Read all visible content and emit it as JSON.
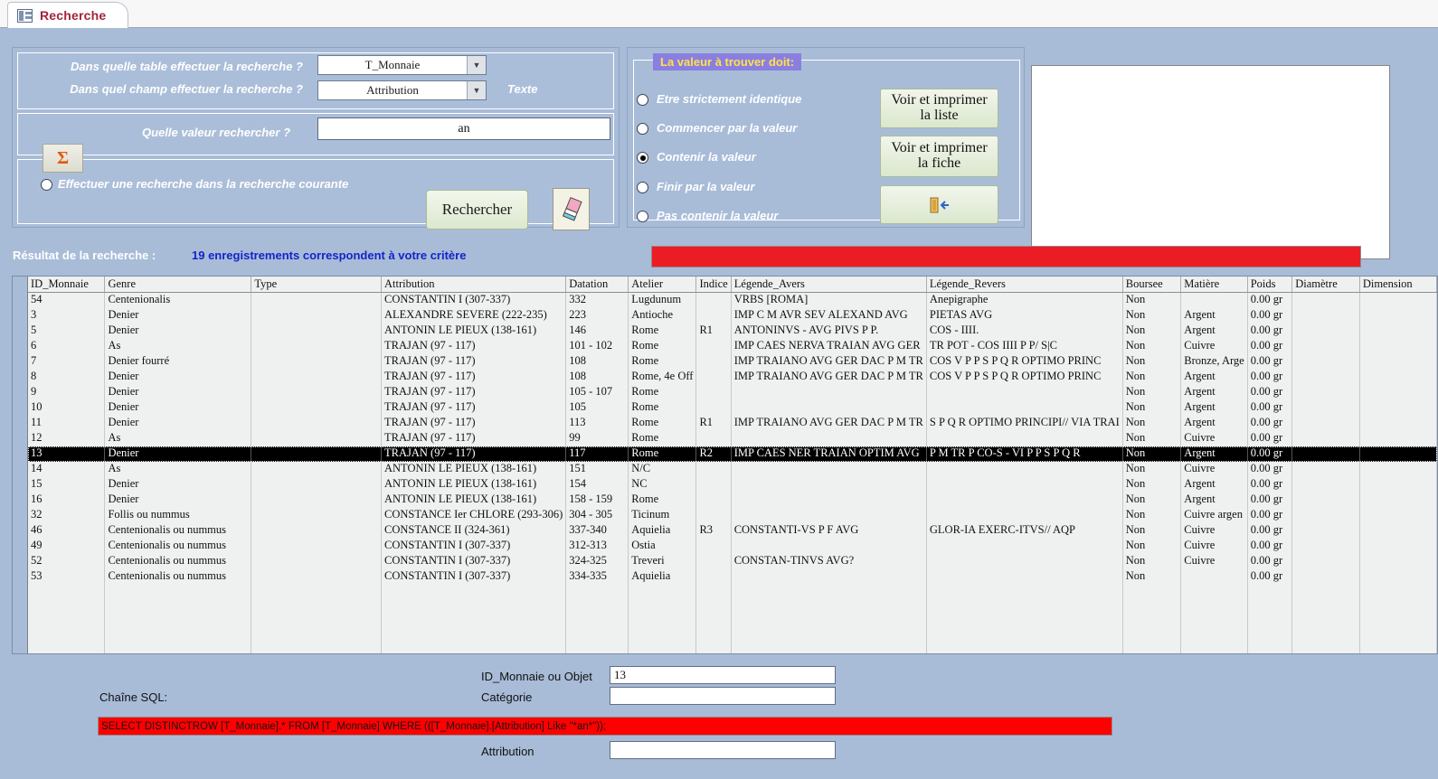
{
  "tab": {
    "label": "Recherche",
    "icon": "table-form-icon"
  },
  "criteria": {
    "table_question": "Dans quelle table effectuer la recherche ?",
    "table_value": "T_Monnaie",
    "field_question": "Dans quel champ effectuer la recherche ?",
    "field_value": "Attribution",
    "field_type": "Texte",
    "value_question": "Quelle valeur rechercher ?",
    "value_entered": "an",
    "sigma_symbol": "Σ",
    "subsearch_label": "Effectuer une recherche dans la recherche courante",
    "subsearch_checked": false,
    "search_button": "Rechercher",
    "eraser_icon": "eraser-icon"
  },
  "mode": {
    "legend": "La valeur à trouver doit:",
    "options": [
      {
        "label": "Etre strictement identique",
        "checked": false
      },
      {
        "label": "Commencer par la valeur",
        "checked": false
      },
      {
        "label": "Contenir la valeur",
        "checked": true
      },
      {
        "label": "Finir par la valeur",
        "checked": false
      },
      {
        "label": "Pas contenir la valeur",
        "checked": false
      }
    ]
  },
  "actions": {
    "print_list_line1": "Voir et imprimer",
    "print_list_line2": "la liste",
    "print_record_line1": "Voir et imprimer",
    "print_record_line2": "la fiche",
    "exit_icon": "exit-door-icon"
  },
  "result": {
    "label": "Résultat de la recherche :",
    "count_text": "19 enregistrements correspondent à votre critère",
    "banner_text": ""
  },
  "grid": {
    "columns": [
      "ID_Monnaie",
      "Genre",
      "Type",
      "Attribution",
      "Datation",
      "Atelier",
      "Indice",
      "Légende_Avers",
      "Légende_Revers",
      "Boursee",
      "Matière",
      "Poids",
      "Diamètre",
      "Dimension"
    ],
    "selected_row_index": 10,
    "rows": [
      [
        "54",
        "Centenionalis",
        "",
        "CONSTANTIN I (307-337)",
        "332",
        "Lugdunum",
        "",
        "VRBS [ROMA]",
        "Anepigraphe",
        "Non",
        "",
        "0.00 gr",
        "",
        ""
      ],
      [
        "3",
        "Denier",
        "",
        "ALEXANDRE SEVERE (222-235)",
        "223",
        "Antioche",
        "",
        "IMP C M AVR SEV ALEXAND AVG",
        "PIETAS AVG",
        "Non",
        "Argent",
        "0.00 gr",
        "",
        ""
      ],
      [
        "5",
        "Denier",
        "",
        "ANTONIN LE PIEUX (138-161)",
        "146",
        "Rome",
        "R1",
        "ANTONINVS - AVG PIVS P P.",
        "COS - IIII.",
        "Non",
        "Argent",
        "0.00 gr",
        "",
        ""
      ],
      [
        "6",
        "As",
        "",
        "TRAJAN (97 - 117)",
        "101 - 102",
        "Rome",
        "",
        "IMP CAES NERVA TRAIAN AVG GER",
        "TR POT - COS IIII P P/ S|C",
        "Non",
        "Cuivre",
        "0.00 gr",
        "",
        ""
      ],
      [
        "7",
        "Denier fourré",
        "",
        "TRAJAN (97 - 117)",
        "108",
        "Rome",
        "",
        "IMP TRAIANO AVG GER DAC P M TR",
        "COS V P P S P Q R OPTIMO PRINC",
        "Non",
        "Bronze, Arge",
        "0.00 gr",
        "",
        ""
      ],
      [
        "8",
        "Denier",
        "",
        "TRAJAN (97 - 117)",
        "108",
        "Rome, 4e Off",
        "",
        "IMP TRAIANO AVG GER DAC P M TR",
        "COS V P P S P Q R OPTIMO PRINC",
        "Non",
        "Argent",
        "0.00 gr",
        "",
        ""
      ],
      [
        "9",
        "Denier",
        "",
        "TRAJAN (97 - 117)",
        "105 - 107",
        "Rome",
        "",
        "",
        "",
        "Non",
        "Argent",
        "0.00 gr",
        "",
        ""
      ],
      [
        "10",
        "Denier",
        "",
        "TRAJAN (97 - 117)",
        "105",
        "Rome",
        "",
        "",
        "",
        "Non",
        "Argent",
        "0.00 gr",
        "",
        ""
      ],
      [
        "11",
        "Denier",
        "",
        "TRAJAN (97 - 117)",
        "113",
        "Rome",
        "R1",
        "IMP TRAIANO AVG GER DAC P M TR",
        "S P Q R OPTIMO PRINCIPI// VIA TRAI",
        "Non",
        "Argent",
        "0.00 gr",
        "",
        ""
      ],
      [
        "12",
        "As",
        "",
        "TRAJAN (97 - 117)",
        "99",
        "Rome",
        "",
        "",
        "",
        "Non",
        "Cuivre",
        "0.00 gr",
        "",
        ""
      ],
      [
        "13",
        "Denier",
        "",
        "TRAJAN (97 - 117)",
        "117",
        "Rome",
        "R2",
        "IMP CAES NER TRAIAN OPTIM AVG",
        "P M TR P CO-S - VI P P S P Q R",
        "Non",
        "Argent",
        "0.00 gr",
        "",
        ""
      ],
      [
        "14",
        "As",
        "",
        "ANTONIN LE PIEUX (138-161)",
        "151",
        "N/C",
        "",
        "",
        "",
        "Non",
        "Cuivre",
        "0.00 gr",
        "",
        ""
      ],
      [
        "15",
        "Denier",
        "",
        "ANTONIN LE PIEUX (138-161)",
        "154",
        "NC",
        "",
        "",
        "",
        "Non",
        "Argent",
        "0.00 gr",
        "",
        ""
      ],
      [
        "16",
        "Denier",
        "",
        "ANTONIN LE PIEUX (138-161)",
        "158 - 159",
        "Rome",
        "",
        "",
        "",
        "Non",
        "Argent",
        "0.00 gr",
        "",
        ""
      ],
      [
        "32",
        "Follis ou nummus",
        "",
        "CONSTANCE Ier CHLORE (293-306)",
        "304 - 305",
        "Ticinum",
        "",
        "",
        "",
        "Non",
        "Cuivre argen",
        "0.00 gr",
        "",
        ""
      ],
      [
        "46",
        "Centenionalis ou nummus",
        "",
        "CONSTANCE II (324-361)",
        "337-340",
        "Aquielia",
        "R3",
        "CONSTANTI-VS P F AVG",
        "GLOR-IA EXERC-ITVS// AQP",
        "Non",
        "Cuivre",
        "0.00 gr",
        "",
        ""
      ],
      [
        "49",
        "Centenionalis ou nummus",
        "",
        "CONSTANTIN I (307-337)",
        "312-313",
        "Ostia",
        "",
        "",
        "",
        "Non",
        "Cuivre",
        "0.00 gr",
        "",
        ""
      ],
      [
        "52",
        "Centenionalis ou nummus",
        "",
        "CONSTANTIN I (307-337)",
        "324-325",
        "Treveri",
        "",
        "CONSTAN-TINVS AVG?",
        "",
        "Non",
        "Cuivre",
        "0.00 gr",
        "",
        ""
      ],
      [
        "53",
        "Centenionalis ou nummus",
        "",
        "CONSTANTIN I (307-337)",
        "334-335",
        "Aquielia",
        "",
        "",
        "",
        "Non",
        "",
        "0.00 gr",
        "",
        ""
      ]
    ]
  },
  "footer": {
    "sql_label": "Chaîne SQL:",
    "id_label": "ID_Monnaie ou Objet",
    "id_value": "13",
    "category_label": "Catégorie",
    "category_value": "",
    "attribution_label": "Attribution",
    "attribution_value": "",
    "sql_text": "SELECT DISTINCTROW [T_Monnaie].* FROM [T_Monnaie] WHERE (([T_Monnaie].[Attribution] Like \"*an*\"));"
  },
  "colors": {
    "form_background": "#a8bcd8",
    "accent_red": "#ec1c24",
    "sql_red": "#ff0000",
    "legend_purple": "#8a7fe0",
    "legend_yellow": "#ffe14d",
    "count_blue": "#1324c9",
    "tab_text": "#a3243b",
    "sigma_orange": "#e3590d"
  }
}
